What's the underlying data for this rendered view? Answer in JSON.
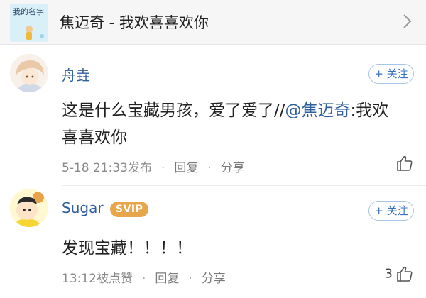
{
  "song": {
    "title": "焦迈奇 - 我欢喜喜欢你",
    "cover_text": "我的名字"
  },
  "comments": [
    {
      "user": "舟垚",
      "follow_label": "+ 关注",
      "text_before": "这是什么宝藏男孩，爱了爱了//",
      "mention": "@焦迈奇",
      "text_after": ":我欢喜喜欢你",
      "time": "5-18 21:33发布",
      "reply_label": "回复",
      "share_label": "分享",
      "like_count": ""
    },
    {
      "user": "Sugar",
      "badge": "SVIP",
      "follow_label": "+ 关注",
      "text": "发现宝藏！！！！",
      "time": "13:12被点赞",
      "reply_label": "回复",
      "share_label": "分享",
      "like_count": "3"
    }
  ],
  "icons": {
    "chevron": "chevron-right-icon",
    "like": "thumbs-up-icon"
  },
  "colors": {
    "username": "#2f5f9a",
    "follow": "#3973c0",
    "svip": "#e8a64a",
    "meta": "#8a8a8a"
  }
}
